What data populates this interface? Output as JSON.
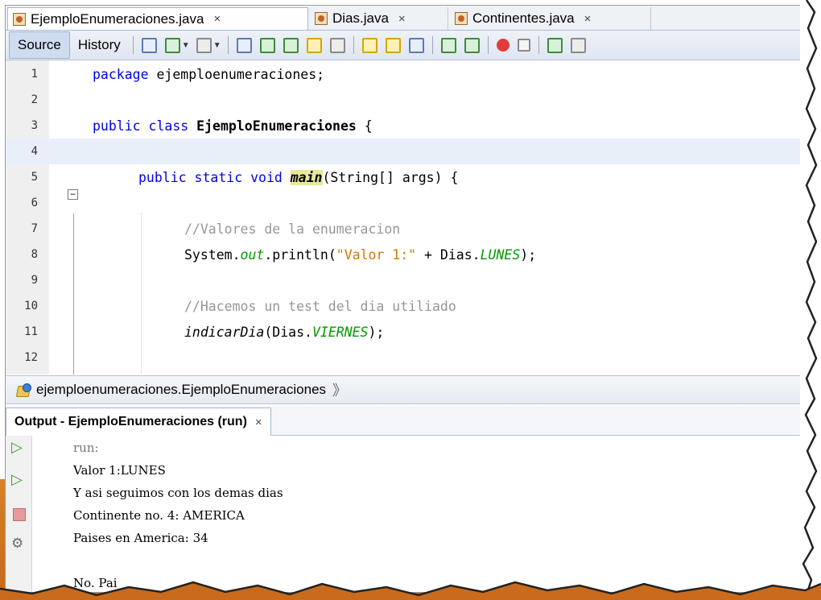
{
  "tabs": [
    {
      "label": "EjemploEnumeraciones.java",
      "close": "×",
      "active": true
    },
    {
      "label": "Dias.java",
      "close": "×",
      "active": false
    },
    {
      "label": "Continentes.java",
      "close": "×",
      "active": false
    }
  ],
  "toolbar": {
    "source_label": "Source",
    "history_label": "History"
  },
  "editor": {
    "line_numbers": [
      "1",
      "2",
      "3",
      "4",
      "5",
      "6",
      "7",
      "8",
      "9",
      "10",
      "11",
      "12"
    ],
    "fold_marker": "−",
    "lines": {
      "l1_kw": "package",
      "l1_rest": " ejemploenumeraciones;",
      "l3_kw": "public class",
      "l3_name": "EjemploEnumeraciones",
      "l3_rest": " {",
      "l5_kw": "public static void",
      "l5_method": "main",
      "l5_rest": "(String[] args) {",
      "l7_comment": "//Valores de la enumeracion",
      "l8_a": "System.",
      "l8_out": "out",
      "l8_b": ".println(",
      "l8_str": "\"Valor 1:\"",
      "l8_c": " + Dias.",
      "l8_field": "LUNES",
      "l8_d": ");",
      "l10_comment": "//Hacemos un test del dia utiliado",
      "l11_method": "indicarDia",
      "l11_a": "(Dias.",
      "l11_field": "VIERNES",
      "l11_b": ");"
    }
  },
  "navbar": {
    "path": "ejemploenumeraciones.EjemploEnumeraciones",
    "arrow": "》"
  },
  "output": {
    "title": "Output - EjemploEnumeraciones (run)",
    "close": "×",
    "lines": [
      "run:",
      "Valor 1:LUNES",
      "Y asi seguimos con los demas dias",
      "Continente no. 4: AMERICA",
      "Paises en America: 34",
      "",
      "No. Pai"
    ]
  }
}
